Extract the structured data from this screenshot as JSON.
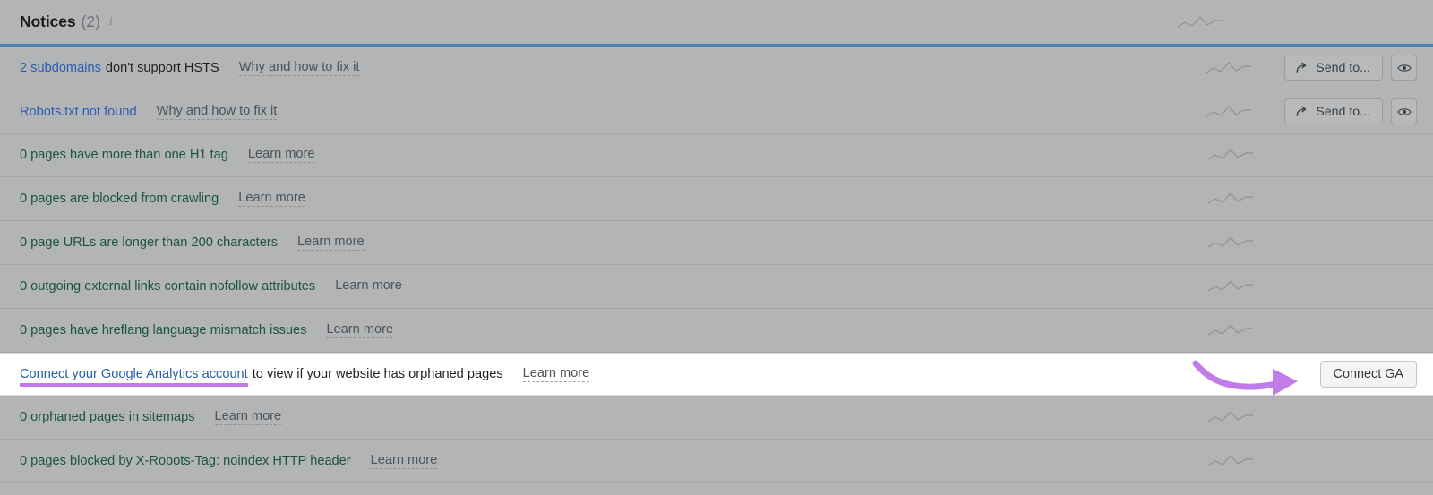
{
  "header": {
    "title": "Notices",
    "count": "(2)",
    "info_icon": "info-icon",
    "accent_rule_color": "#4a80b5"
  },
  "colors": {
    "page_background": "#b2b4b6",
    "link_blue": "#2a5db0",
    "zero_row_text": "#1b5341",
    "highlight_purple": "#c07de8",
    "rule_blue": "#4a80b5",
    "highlighted_row_background": "#ffffff"
  },
  "rows": [
    {
      "lead": "2 subdomains",
      "lead_is_link": true,
      "rest": "don't support HSTS",
      "link": "Why and how to fix it",
      "zero": false,
      "sparkline": true,
      "send_to": "Send to...",
      "has_eye": true
    },
    {
      "lead": "Robots.txt not found",
      "lead_is_link": true,
      "rest": "",
      "link": "Why and how to fix it",
      "zero": false,
      "sparkline": true,
      "send_to": "Send to...",
      "has_eye": true
    },
    {
      "lead": "",
      "lead_is_link": false,
      "rest": "0 pages have more than one H1 tag",
      "link": "Learn more",
      "zero": true,
      "sparkline": true,
      "send_to": null,
      "has_eye": false
    },
    {
      "lead": "",
      "lead_is_link": false,
      "rest": "0 pages are blocked from crawling",
      "link": "Learn more",
      "zero": true,
      "sparkline": true,
      "send_to": null,
      "has_eye": false
    },
    {
      "lead": "",
      "lead_is_link": false,
      "rest": "0 page URLs are longer than 200 characters",
      "link": "Learn more",
      "zero": true,
      "sparkline": true,
      "send_to": null,
      "has_eye": false
    },
    {
      "lead": "",
      "lead_is_link": false,
      "rest": "0 outgoing external links contain nofollow attributes",
      "link": "Learn more",
      "zero": true,
      "sparkline": true,
      "send_to": null,
      "has_eye": false
    },
    {
      "lead": "",
      "lead_is_link": false,
      "rest": "0 pages have hreflang language mismatch issues",
      "link": "Learn more",
      "zero": true,
      "sparkline": true,
      "send_to": null,
      "has_eye": false
    }
  ],
  "highlighted_row": {
    "link_text": "Connect your Google Analytics account",
    "rest_text": "to view if your website has orphaned pages",
    "learn_more": "Learn more",
    "button_label": "Connect GA",
    "annotation_arrow": "curved-arrow-icon"
  },
  "rows_after": [
    {
      "lead": "",
      "lead_is_link": false,
      "rest": "0 orphaned pages in sitemaps",
      "link": "Learn more",
      "zero": true,
      "sparkline": true,
      "send_to": null,
      "has_eye": false
    },
    {
      "lead": "",
      "lead_is_link": false,
      "rest": "0 pages blocked by X-Robots-Tag: noindex HTTP header",
      "link": "Learn more",
      "zero": true,
      "sparkline": true,
      "send_to": null,
      "has_eye": false
    }
  ]
}
